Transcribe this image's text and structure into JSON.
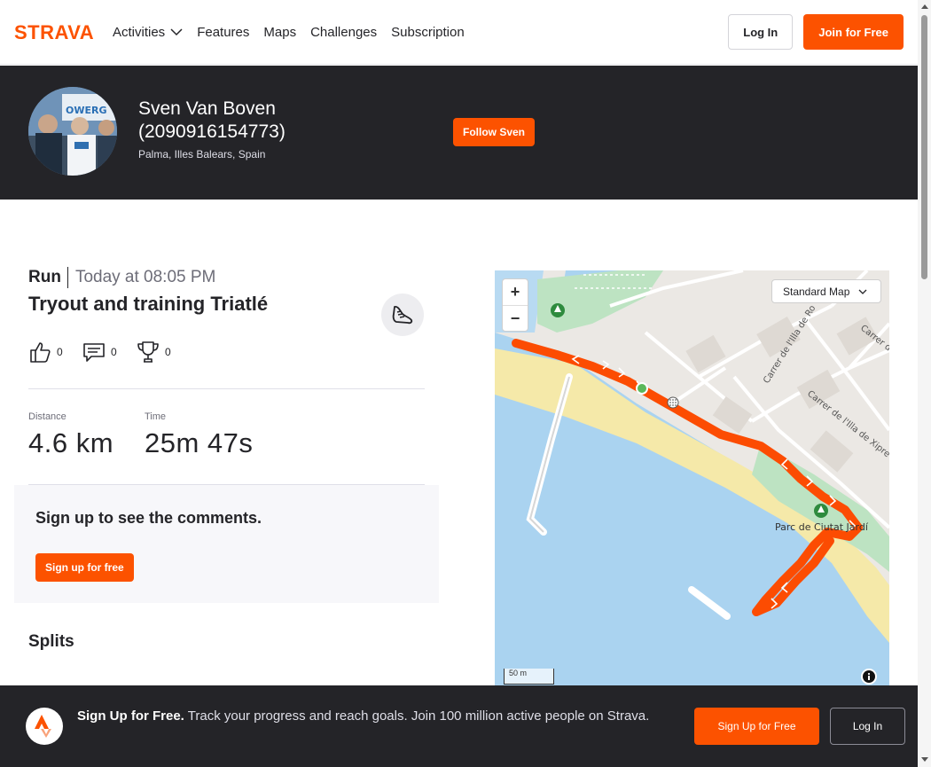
{
  "nav": {
    "brand": "STRAVA",
    "links": [
      "Activities",
      "Features",
      "Maps",
      "Challenges",
      "Subscription"
    ],
    "login_label": "Log In",
    "join_label": "Join for Free",
    "brand_color": "#fc5200"
  },
  "athlete": {
    "name": "Sven Van Boven (2090916154773)",
    "location": "Palma, Illes Balears, Spain",
    "follow_label": "Follow Sven"
  },
  "activity": {
    "type": "Run",
    "date": "Today at 08:05 PM",
    "title": "Tryout and training Triatlé",
    "kudos_count": "0",
    "comments_count": "0",
    "achievements_count": "0",
    "stats": [
      {
        "label": "Distance",
        "value": "4.6 km"
      },
      {
        "label": "Time",
        "value": "25m 47s"
      }
    ]
  },
  "comments_prompt": {
    "title": "Sign up to see the comments.",
    "button_label": "Sign up for free"
  },
  "splits": {
    "heading": "Splits"
  },
  "map": {
    "style_label": "Standard Map",
    "zoom_in": "+",
    "zoom_out": "−",
    "scale_label": "50 m",
    "place_label": "Parc de Ciutat Jardí",
    "street_labels": [
      "Carrer de l'Illa de Ro",
      "Carrer de l'Illa de Xipre",
      "Carrer d"
    ],
    "route_color": "#fc4c02"
  },
  "banner": {
    "headline": "Sign Up for Free.",
    "text": "Track your progress and reach goals. Join 100 million active people on Strava.",
    "signup_label": "Sign Up for Free",
    "login_label": "Log In"
  }
}
